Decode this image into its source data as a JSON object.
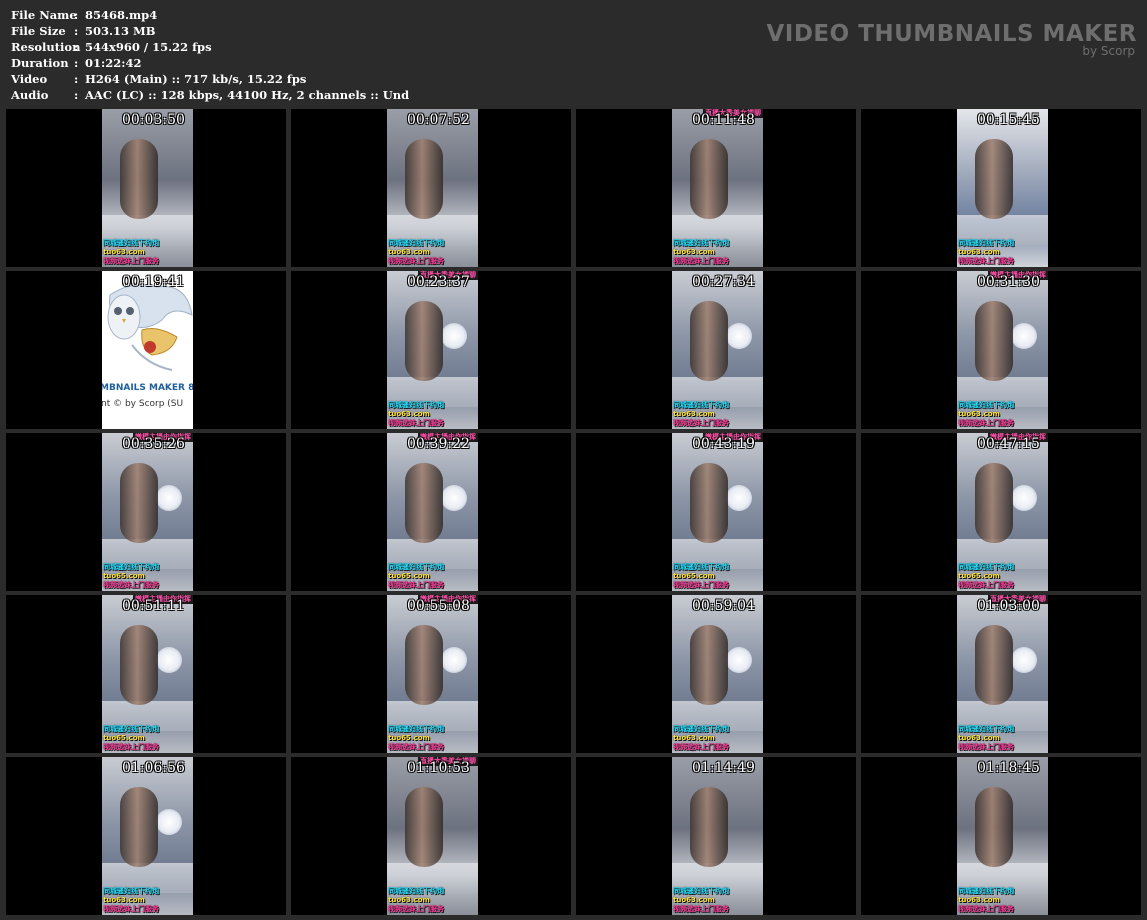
{
  "info": {
    "rows": [
      {
        "label": "File Name",
        "sep": ":",
        "value": "85468.mp4"
      },
      {
        "label": "File Size",
        "sep": ":",
        "value": "503.13 MB"
      },
      {
        "label": "Resolution",
        "sep": ":",
        "value": "544x960 / 15.22 fps"
      },
      {
        "label": "Duration",
        "sep": ":",
        "value": "01:22:42"
      },
      {
        "label": "Video",
        "sep": ":",
        "value": "H264 (Main) :: 717 kb/s, 15.22 fps"
      },
      {
        "label": "Audio",
        "sep": ":",
        "value": "AAC (LC) :: 128 kbps, 44100 Hz, 2 channels :: Und"
      }
    ]
  },
  "brand": {
    "title": "VIDEO THUMBNAILS MAKER",
    "subtitle": "by Scorp"
  },
  "colors": {
    "background": "#2b2b2b",
    "thumb_bg": "#000000",
    "caption_cyan": "#26e0ff",
    "caption_yellow": "#ffe23a",
    "caption_pink": "#ff3f9c"
  },
  "captions": {
    "top_a": "直播大秀美女裸聊",
    "top_b": "嫩模主播由你指挥",
    "line1": "同城骚妇线下约炮",
    "line2_a": "tuo63.com",
    "line2_b": "tuo65.com",
    "line3": "视频选妹上门服务"
  },
  "logo": {
    "title": "MBNAILS MAKER 8",
    "copyright": "nt © by Scorp (SU"
  },
  "thumbnails": [
    {
      "time": "00:03:50",
      "style": "room",
      "top": "",
      "url": "tuo63.com"
    },
    {
      "time": "00:07:52",
      "style": "room",
      "top": "",
      "url": "tuo63.com"
    },
    {
      "time": "00:11:48",
      "style": "room",
      "top": "直播大秀美女裸聊",
      "url": "tuo63.com"
    },
    {
      "time": "00:15:45",
      "style": "light",
      "top": "",
      "url": "tuo63.com"
    },
    {
      "time": "00:19:41",
      "style": "logo",
      "top": "",
      "url": ""
    },
    {
      "time": "00:23:37",
      "style": "bed",
      "top": "直播大秀美女裸聊",
      "url": "tuo63.com"
    },
    {
      "time": "00:27:34",
      "style": "bed",
      "top": "",
      "url": "tuo63.com"
    },
    {
      "time": "00:31:30",
      "style": "bed",
      "top": "嫩模主播由你指挥",
      "url": "tuo63.com"
    },
    {
      "time": "00:35:26",
      "style": "bed",
      "top": "嫩模主播由你指挥",
      "url": "tuo65.com"
    },
    {
      "time": "00:39:22",
      "style": "bed",
      "top": "嫩模主播由你指挥",
      "url": "tuo65.com"
    },
    {
      "time": "00:43:19",
      "style": "bed",
      "top": "嫩模主播由你指挥",
      "url": "tuo65.com"
    },
    {
      "time": "00:47:15",
      "style": "bed",
      "top": "嫩模主播由你指挥",
      "url": "tuo65.com"
    },
    {
      "time": "00:51:11",
      "style": "bed",
      "top": "嫩模主播由你指挥",
      "url": "tuo65.com"
    },
    {
      "time": "00:55:08",
      "style": "bed",
      "top": "嫩模主播由你指挥",
      "url": "tuo65.com"
    },
    {
      "time": "00:59:04",
      "style": "bed",
      "top": "",
      "url": "tuo63.com"
    },
    {
      "time": "01:03:00",
      "style": "bed",
      "top": "直播大秀美女裸聊",
      "url": "tuo63.com"
    },
    {
      "time": "01:06:56",
      "style": "bed",
      "top": "",
      "url": "tuo63.com"
    },
    {
      "time": "01:10:53",
      "style": "room",
      "top": "直播大秀美女裸聊",
      "url": "tuo63.com"
    },
    {
      "time": "01:14:49",
      "style": "room",
      "top": "",
      "url": "tuo63.com"
    },
    {
      "time": "01:18:45",
      "style": "room",
      "top": "",
      "url": "tuo63.com"
    }
  ]
}
